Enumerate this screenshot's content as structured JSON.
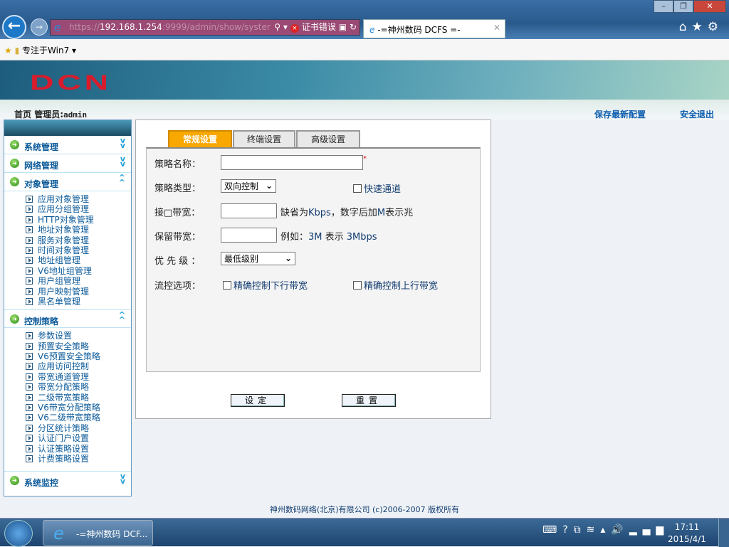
{
  "browser": {
    "url_prefix": "https://",
    "url_host": "192.168.1.254",
    "url_rest": ":9999/admin/show/syster",
    "cert_error": "证书错误",
    "tab_title": "-=神州数码 DCFS =-",
    "favorites_item": "专注于Win7"
  },
  "header": {
    "logo": "DCN",
    "home": "首页",
    "admin_label": "管理员:",
    "admin_name": "admin",
    "save_config": "保存最新配置",
    "logout": "安全退出"
  },
  "sidebar": {
    "groups": [
      {
        "label": "系统管理",
        "expanded": false
      },
      {
        "label": "网络管理",
        "expanded": false
      },
      {
        "label": "对象管理",
        "expanded": true,
        "items": [
          "应用对象管理",
          "应用分组管理",
          "HTTP对象管理",
          "地址对象管理",
          "服务对象管理",
          "时间对象管理",
          "地址组管理",
          "V6地址组管理",
          "用户组管理",
          "用户映射管理",
          "黑名单管理"
        ]
      },
      {
        "label": "控制策略",
        "expanded": true,
        "items": [
          "参数设置",
          "预置安全策略",
          "V6预置安全策略",
          "应用访问控制",
          "带宽通道管理",
          "带宽分配策略",
          "二级带宽策略",
          "V6带宽分配策略",
          "V6二级带宽策略",
          "分区统计策略",
          "认证门户设置",
          "认证策略设置",
          "计费策略设置"
        ]
      },
      {
        "label": "系统监控",
        "expanded": false
      }
    ]
  },
  "tabs": [
    "常规设置",
    "终端设置",
    "高级设置"
  ],
  "form": {
    "name_label": "策略名称：",
    "name_value": "",
    "required_mark": "*",
    "type_label": "策略类型：",
    "type_value": "双向控制",
    "fast_channel": "快速通道",
    "iface_label": "接□带宽：",
    "iface_hint_a": "缺省为",
    "iface_hint_b": "Kbps",
    "iface_hint_c": "，数字后加",
    "iface_hint_d": "M",
    "iface_hint_e": "表示兆",
    "reserve_label": "保留带宽：",
    "reserve_hint_a": "例如：",
    "reserve_hint_b": "3M",
    "reserve_hint_c": " 表示 ",
    "reserve_hint_d": "3Mbps",
    "priority_label": "优 先 级 ：",
    "priority_value": "最低级别",
    "flow_label": "流控选项：",
    "down_option": "精确控制下行带宽",
    "up_option": "精确控制上行带宽",
    "set_button": "设定",
    "reset_button": "重置"
  },
  "footer": "神州数码网络(北京)有限公司 (c)2006-2007 版权所有",
  "taskbar": {
    "task_label": "-=神州数码 DCF...",
    "time": "17:11",
    "date": "2015/4/1"
  }
}
